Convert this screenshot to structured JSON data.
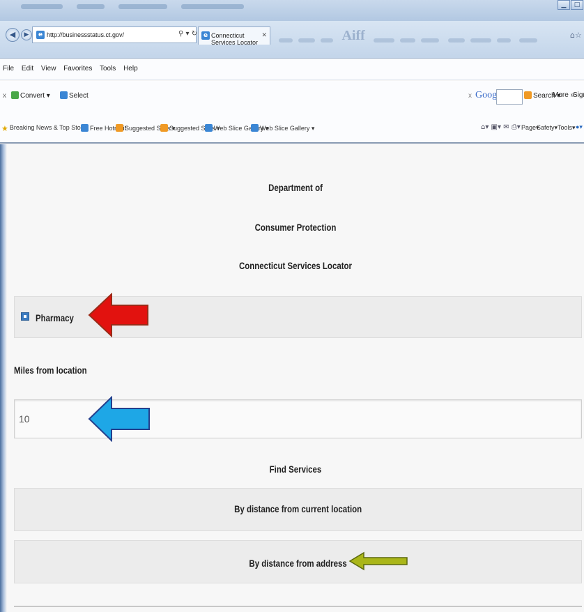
{
  "browser": {
    "address_url": "http://businessstatus.ct.gov/",
    "tab_title": "Connecticut Services Locator",
    "menu": [
      "File",
      "Edit",
      "View",
      "Favorites",
      "Tools",
      "Help"
    ],
    "command_bar": {
      "convert": "Convert",
      "select": "Select",
      "google_search": "Search",
      "more": "More",
      "sign_in": "Sign I"
    },
    "favorites": [
      "Breaking News & Top Sto...",
      "Free Hotmail",
      "Suggested Sites",
      "Suggested Sites",
      "Web Slice Gallery",
      "Web Slice Gallery"
    ],
    "right_tools": {
      "page": "Page",
      "safety": "Safety",
      "tools": "Tools"
    }
  },
  "page": {
    "heading_line1": "Department of",
    "heading_line2": "Consumer Protection",
    "heading_line3": "Connecticut Services Locator",
    "service_option": "Pharmacy",
    "miles_label": "Miles from location",
    "miles_value": "10",
    "find_services": "Find Services",
    "btn_current_location": "By distance from current location",
    "btn_address": "By distance from address"
  },
  "colors": {
    "arrow_red": "#e2120f",
    "arrow_blue": "#1ea7e6",
    "arrow_olive": "#aab619"
  }
}
